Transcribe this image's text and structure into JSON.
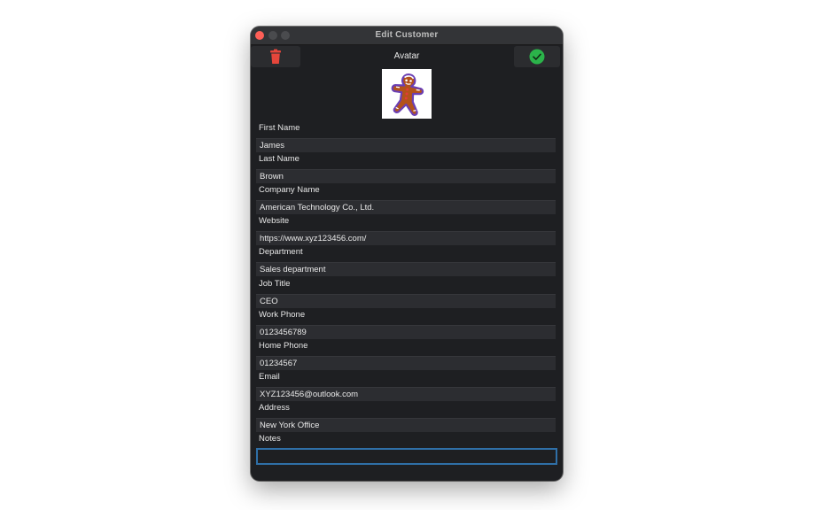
{
  "window": {
    "title": "Edit Customer"
  },
  "toolbar": {
    "avatar_label": "Avatar",
    "delete_icon": "trash-icon",
    "save_icon": "checkmark-icon"
  },
  "avatar": {
    "icon": "gingerbread-man-image"
  },
  "fields": [
    {
      "label": "First Name",
      "value": "James"
    },
    {
      "label": "Last Name",
      "value": "Brown"
    },
    {
      "label": "Company Name",
      "value": "American Technology Co., Ltd."
    },
    {
      "label": "Website",
      "value": "https://www.xyz123456.com/"
    },
    {
      "label": "Department",
      "value": "Sales department"
    },
    {
      "label": "Job Title",
      "value": "CEO"
    },
    {
      "label": "Work Phone",
      "value": "0123456789"
    },
    {
      "label": "Home Phone",
      "value": "01234567"
    },
    {
      "label": "Email",
      "value": "XYZ123456@outlook.com"
    },
    {
      "label": "Address",
      "value": "New York Office"
    },
    {
      "label": "Notes",
      "value": ""
    }
  ],
  "colors": {
    "accent_focus": "#2f6fa7",
    "delete": "#e5463b",
    "confirm": "#2bb34a"
  }
}
